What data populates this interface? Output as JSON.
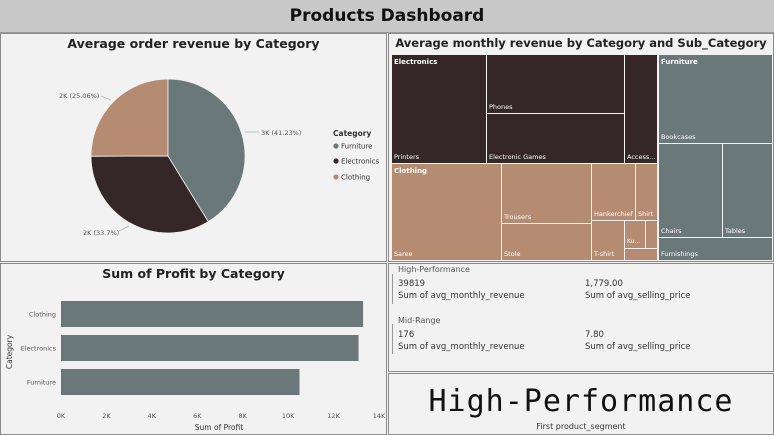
{
  "header": {
    "title": "Products Dashboard"
  },
  "pie": {
    "title": "Average order revenue by Category",
    "legend_title": "Category",
    "labels": [
      "3K (41.23%)",
      "2K (33.7%)",
      "2K (25.06%)"
    ]
  },
  "treemap": {
    "title": "Average monthly revenue by Category and Sub_Category",
    "groups": {
      "electronics": "Electronics",
      "furniture": "Furniture",
      "clothing": "Clothing"
    },
    "cells": {
      "phones": "Phones",
      "printers": "Printers",
      "games": "Electronic Games",
      "access": "Access...",
      "bookcases": "Bookcases",
      "chairs": "Chairs",
      "tables": "Tables",
      "furnishings": "Furnishings",
      "saree": "Saree",
      "trousers": "Trousers",
      "stole": "Stole",
      "hankerchief": "Hankerchief",
      "shirt": "Shirt",
      "tshirt": "T-shirt",
      "ku": "Ku..."
    }
  },
  "bar": {
    "title": "Sum of Profit by Category",
    "xlabel": "Sum of Profit",
    "ylabel": "Category"
  },
  "segments": [
    {
      "name": "High-Performance",
      "v1": "39819",
      "v1_label": "Sum of avg_monthly_revenue",
      "v2": "1,779.00",
      "v2_label": "Sum of avg_selling_price"
    },
    {
      "name": "Mid-Range",
      "v1": "176",
      "v1_label": "Sum of avg_monthly_revenue",
      "v2": "7.80",
      "v2_label": "Sum of avg_selling_price"
    }
  ],
  "card": {
    "value": "High-Performance",
    "label": "First product_segment"
  },
  "colors": {
    "furniture": "#6b7879",
    "electronics": "#352727",
    "clothing": "#b58b72",
    "bar": "#6b7879"
  },
  "chart_data": [
    {
      "type": "pie",
      "title": "Average order revenue by Category",
      "categories": [
        "Furniture",
        "Electronics",
        "Clothing"
      ],
      "values": [
        41.23,
        33.7,
        25.06
      ],
      "value_labels": [
        "3K",
        "2K",
        "2K"
      ],
      "legend": "right"
    },
    {
      "type": "bar",
      "title": "Sum of Profit by Category",
      "orientation": "horizontal",
      "categories": [
        "Clothing",
        "Electronics",
        "Furniture"
      ],
      "values": [
        13300,
        13100,
        10500
      ],
      "xlabel": "Sum of Profit",
      "ylabel": "Category",
      "xlim": [
        0,
        14000
      ],
      "xticks": [
        "0K",
        "2K",
        "4K",
        "6K",
        "8K",
        "10K",
        "12K",
        "14K"
      ]
    }
  ]
}
